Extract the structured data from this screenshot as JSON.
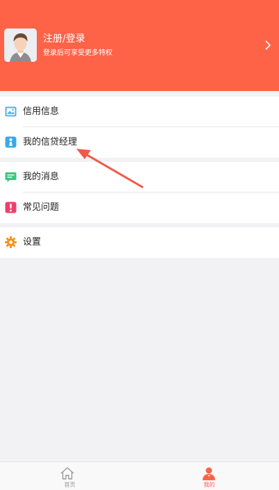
{
  "colors": {
    "brand": "#fe6347",
    "background": "#f2f2f5",
    "tab_inactive": "#999999",
    "annotation_arrow": "#ef5a4a"
  },
  "profile": {
    "title": "注册/登录",
    "subtitle": "登录后可享受更多特权",
    "avatar_icon": "user-avatar-icon",
    "chevron_icon": "chevron-right-icon"
  },
  "menu": {
    "group1": [
      {
        "label": "信用信息",
        "icon": "credit-info-icon"
      },
      {
        "label": "我的信贷经理",
        "icon": "loan-manager-icon"
      }
    ],
    "group2": [
      {
        "label": "我的消息",
        "icon": "message-icon"
      },
      {
        "label": "常见问题",
        "icon": "faq-icon"
      }
    ],
    "group3": [
      {
        "label": "设置",
        "icon": "gear-icon"
      }
    ]
  },
  "tabbar": {
    "home_label": "首页",
    "mine_label": "我的",
    "active": "mine"
  }
}
